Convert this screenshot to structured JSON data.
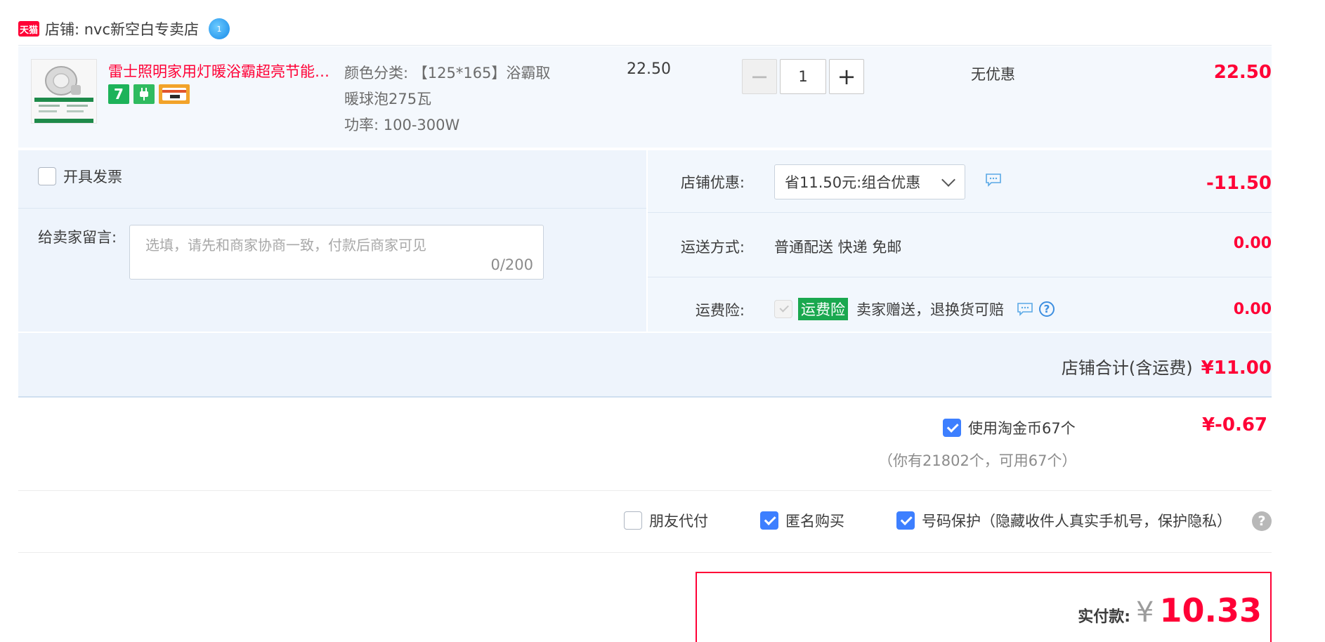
{
  "shop": {
    "badge": "天猫",
    "name": "店铺: nvc新空白专卖店",
    "ww_badge": "1"
  },
  "item": {
    "title": "雷士照明家用灯暖浴霸超亮节能灯泡",
    "badges": [
      {
        "text": "7",
        "color": "#1db35a"
      },
      {
        "text": "",
        "color": "#2fbb5f"
      },
      {
        "text": "",
        "color": "#f2a32a"
      }
    ],
    "sku_line1": "颜色分类: 【125*165】浴霸取",
    "sku_line2": "暖球泡275瓦",
    "sku_line3": "功率: 100-300W",
    "unit_price": "22.50",
    "qty_minus": "−",
    "quantity": "1",
    "qty_plus": "+",
    "discount": "无优惠",
    "total": "22.50"
  },
  "options": {
    "invoice_label": "开具发票",
    "invoice_checked": false,
    "message_label": "给卖家留言:",
    "message_placeholder": "选填，请先和商家协商一致，付款后商家可见",
    "message_count": "0/200",
    "coupon_label": "店铺优惠:",
    "coupon_value": "省11.50元:组合优惠",
    "coupon_amount": "-11.50",
    "shipping_label": "运送方式:",
    "shipping_value": "普通配送 快递 免邮",
    "shipping_amount": "0.00",
    "insurance_label": "运费险:",
    "insurance_tag": "运费险",
    "insurance_text": "卖家赠送，退换货可赔",
    "insurance_help": "?",
    "insurance_amount": "0.00"
  },
  "shop_total": {
    "label": "店铺合计(含运费)",
    "amount": "¥11.00"
  },
  "coins": {
    "label": "使用淘金币67个",
    "sub": "（你有21802个，可用67个）",
    "amount": "¥-0.67",
    "checked": true
  },
  "services": {
    "friend_pay": "朋友代付",
    "anonymous": "匿名购买",
    "phone_protect": "号码保护（隐藏收件人真实手机号，保护隐私）",
    "help": "?"
  },
  "payment": {
    "label": "实付款:",
    "currency": "¥",
    "amount": "10.33"
  },
  "colors": {
    "accent": "#ff0036",
    "checkbox": "#3d7fff",
    "panel": "#eef4fc",
    "insurance_tag": "#1aa84f"
  }
}
